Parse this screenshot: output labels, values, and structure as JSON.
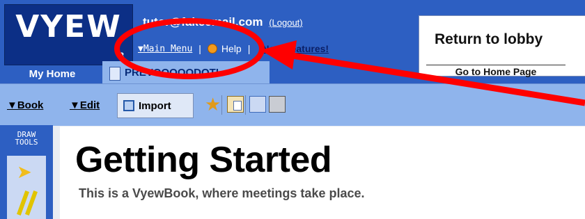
{
  "header": {
    "logo": "VYEW",
    "logo_sub": "3",
    "user_email": "tutor@fakeemail.com",
    "logout_label": "(Logout)",
    "main_menu_label": "▼Main Menu",
    "separator": "|",
    "help_label": "Help",
    "new_features_label": "New Features!"
  },
  "lobby": {
    "return_label": "Return to lobby",
    "home_label": "Go to Home Page"
  },
  "tabs": [
    {
      "label": "My Home"
    },
    {
      "label": "PREVOOOOODQTI"
    }
  ],
  "toolbar": {
    "book_label": "▼Book",
    "edit_label": "▼Edit",
    "import_label": "Import"
  },
  "drawtools": {
    "label_line1": "DRAW",
    "label_line2": "TOOLS"
  },
  "content": {
    "title": "Getting Started",
    "subtitle": "This is a VyewBook, where meetings take place."
  },
  "annotation": {
    "color": "#ff0000"
  }
}
